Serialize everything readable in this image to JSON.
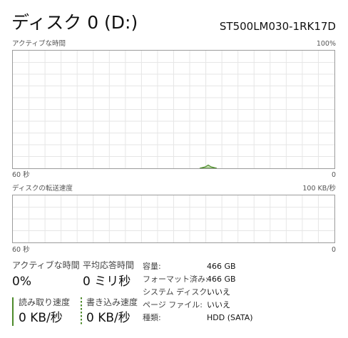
{
  "header": {
    "title": "ディスク 0 (D:)",
    "model": "ST500LM030-1RK17D"
  },
  "active_time_chart": {
    "label": "アクティブな時間",
    "max_label": "100%",
    "time_label": "60 秒",
    "min_label": "0"
  },
  "transfer_chart": {
    "label": "ディスクの転送速度",
    "max_label": "100 KB/秒",
    "time_label": "60 秒",
    "min_label": "0"
  },
  "stats": {
    "active_time": {
      "label": "アクティブな時間",
      "value": "0%"
    },
    "avg_response": {
      "label": "平均応答時間",
      "value": "0 ミリ秒"
    },
    "read_speed": {
      "label": "読み取り速度",
      "value": "0 KB/秒"
    },
    "write_speed": {
      "label": "書き込み速度",
      "value": "0 KB/秒"
    }
  },
  "properties": [
    {
      "key": "容量:",
      "value": "466 GB"
    },
    {
      "key": "フォーマット済み:",
      "value": "466 GB"
    },
    {
      "key": "システム ディスク:",
      "value": "いいえ"
    },
    {
      "key": "ページ ファイル:",
      "value": "いいえ"
    },
    {
      "key": "種類:",
      "value": "HDD (SATA)"
    }
  ],
  "colors": {
    "accent": "#4c8a2a",
    "grid": "#e6e6e6",
    "border": "#9b9b9b"
  }
}
